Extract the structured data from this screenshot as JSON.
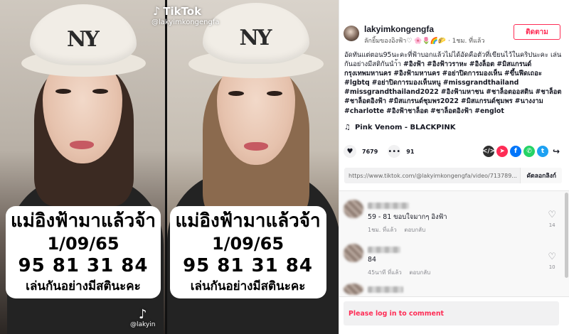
{
  "video": {
    "brand": "TikTok",
    "handle": "@lakyimkongengfa",
    "watermark_handle": "@lakyin",
    "hat_logo": "NY",
    "caption": {
      "line1": "แม่อิงฟ้ามาแล้วจ้า",
      "line2": "1/09/65",
      "line3": "95 81 31 84",
      "line4": "เล่นกันอย่างมีสตินะคะ"
    }
  },
  "post": {
    "username": "lakyimkongengfa",
    "subtitle": "ลักยิ้มของอิงฟ้า♡ 🌸🌷🌈🌮 · 1ชม. ที่แล้ว",
    "follow_label": "ติดตาม",
    "description_text": "อัดทันแต่ตอน95นะคะที่ฟ้าบอกแล้วไม่ได้อัดคือตัวที่เขียนไว้ในคริปนะคะ เล่นกันอย่างมีสติกันนำ้า ",
    "hashtags": [
      "#อิงฟ้า",
      "#อิงฟ้าวราหะ",
      "#อิงล็อต",
      "#มิสแกรนด์กรุงเทพมหานคร",
      "#อิงฟ้ามหานคร",
      "#อย่าปิดการมองเห็น",
      "#ขึ้นฟีดเถอะ",
      "#lgbtq",
      "#อย่าปิดการมองเห็นหนู",
      "#missgrandthailand",
      "#missgrandthailand2022",
      "#อิงฟ้ามหาชน",
      "#ชาล็อตออสติน",
      "#ชาล็อต",
      "#ชาล็อตอิงฟ้า",
      "#มิสแกรนด์ชุมพร2022",
      "#มิสแกรนด์ชุมพร",
      "#นางงาม",
      "#charlotte",
      "#อิงฟ้าชาล็อต",
      "#ชาล็อตอิงฟ้า",
      "#englot"
    ],
    "music": "Pink Venom - BLACKPINK",
    "likes": "7679",
    "comments_count": "91",
    "link_url": "https://www.tiktok.com/@lakyimkongengfa/video/713789...",
    "copy_link_label": "คัดลอกลิงก์"
  },
  "comments": [
    {
      "text": "59 - 81 ขอบใจมากๆ อิงฟ้า",
      "time": "1ชม. ที่แล้ว",
      "reply": "ตอบกลับ",
      "likes": "14"
    },
    {
      "text": "84",
      "time": "45นาที ที่แล้ว",
      "reply": "ตอบกลับ",
      "likes": "10"
    },
    {
      "text": "",
      "time": "",
      "reply": "",
      "likes": ""
    }
  ],
  "login_prompt": "Please log in to comment",
  "colors": {
    "accent": "#fe2c55",
    "text": "#161823",
    "share_embed": "#2f2f2f",
    "share_tiktok": "#fe2c55",
    "share_facebook": "#0075fa",
    "share_whatsapp": "#25d366",
    "share_twitter": "#1da1f2"
  },
  "icons": {
    "like": "heart-icon",
    "comment": "comment-bubble-icon",
    "music": "music-note-icon",
    "share": [
      "embed-icon",
      "tiktok-share-icon",
      "facebook-icon",
      "whatsapp-icon",
      "twitter-icon",
      "share-arrow-icon"
    ]
  }
}
